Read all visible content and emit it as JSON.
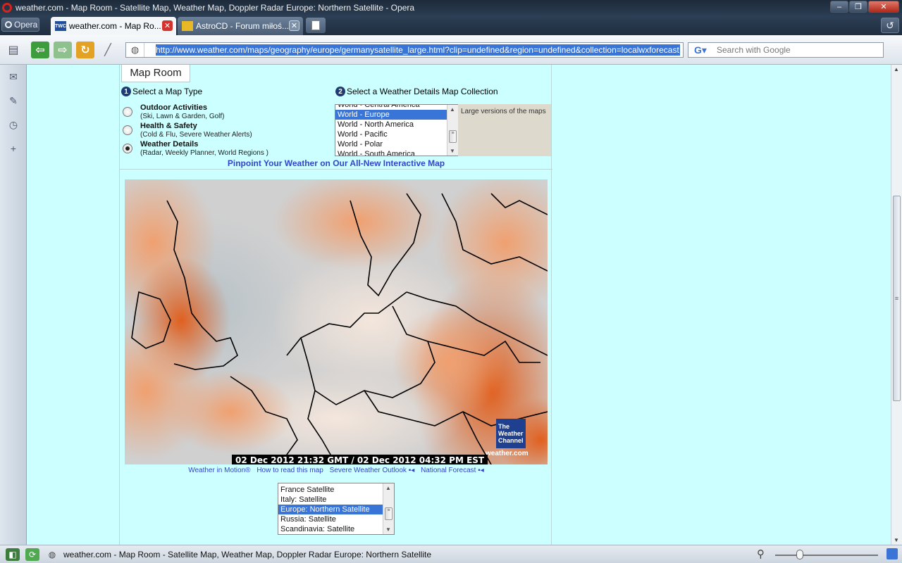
{
  "window": {
    "title": "weather.com - Map Room - Satellite Map, Weather Map, Doppler Radar Europe: Northern Satellite - Opera"
  },
  "menu": {
    "label": "Opera"
  },
  "tabs": [
    {
      "label": "weather.com - Map Ro...",
      "favicon": "TWC",
      "active": true
    },
    {
      "label": "AstroCD - Forum miłoś...",
      "favicon": "",
      "active": false
    }
  ],
  "address_bar": {
    "url": "http://www.weather.com/maps/geography/europe/germanysatellite_large.html?clip=undefined&region=undefined&collection=localwxforecast"
  },
  "search_bar": {
    "placeholder": "Search with Google"
  },
  "page": {
    "tab_title": "Map Room",
    "step1": {
      "num": "1",
      "title": "Select a Map Type"
    },
    "map_types": [
      {
        "title": "Outdoor Activities",
        "sub": "(Ski, Lawn & Garden, Golf)",
        "checked": false
      },
      {
        "title": "Health & Safety",
        "sub": "(Cold & Flu, Severe Weather Alerts)",
        "checked": false
      },
      {
        "title": "Weather Details",
        "sub": "(Radar, Weekly Planner, World Regions )",
        "checked": true
      }
    ],
    "step2": {
      "num": "2",
      "title": "Select a Weather Details Map Collection"
    },
    "collections": [
      "World - Central America",
      "World - Europe",
      "World - North America",
      "World - Pacific",
      "World - Polar",
      "World - South America"
    ],
    "collection_selected": "World - Europe",
    "collection_desc": "Large versions of the maps",
    "pinpoint_link": "Pinpoint Your Weather on Our All-New Interactive Map",
    "map": {
      "timestamp": "02 Dec 2012 21:32 GMT / 02 Dec 2012 04:32 PM EST",
      "logo": [
        "The",
        "Weather",
        "Channel"
      ],
      "logo_url": "weather.com"
    },
    "map_links": [
      "Weather in Motion®",
      "How to read this map",
      "Severe Weather Outlook",
      "National Forecast"
    ],
    "regions": [
      "France Satellite",
      "Italy: Satellite",
      "Europe: Northern Satellite",
      "Russia: Satellite",
      "Scandinavia: Satellite"
    ],
    "region_selected": "Europe: Northern Satellite"
  },
  "status_bar": {
    "text": "weather.com - Map Room - Satellite Map, Weather Map, Doppler Radar Europe: Northern Satellite"
  },
  "colors": {
    "page_bg": "#ccffff",
    "link": "#3344cc",
    "selection": "#3875d7",
    "twc_blue": "#1f3f8f"
  }
}
